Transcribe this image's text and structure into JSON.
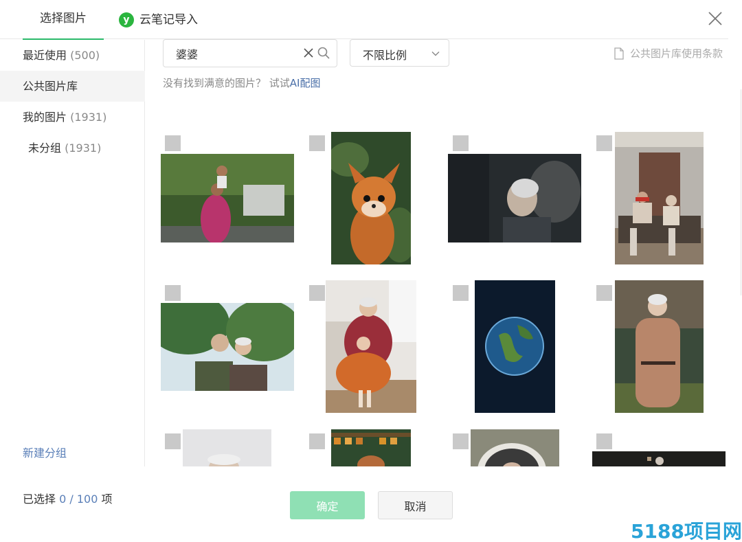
{
  "tabs": {
    "select_image": "选择图片",
    "import": "云笔记导入"
  },
  "sidebar": {
    "recent": {
      "label": "最近使用",
      "count": "(500)"
    },
    "public": {
      "label": "公共图片库"
    },
    "mine": {
      "label": "我的图片",
      "count": "(1931)"
    },
    "ungrouped": {
      "label": "未分组",
      "count": "(1931)"
    },
    "new_group": "新建分组"
  },
  "search": {
    "value": "婆婆",
    "placeholder": ""
  },
  "ratio": {
    "selected": "不限比例"
  },
  "terms": "公共图片库使用条款",
  "hint": {
    "text": "没有找到满意的图片？ 试试",
    "link": "AI配图"
  },
  "footer": {
    "selected_prefix": "已选择 ",
    "selected_value": "0 / 100",
    "selected_suffix": " 项",
    "ok": "确定",
    "cancel": "取消"
  },
  "images": [
    {
      "name": "grandmother-with-child-on-shoulders",
      "selected": false
    },
    {
      "name": "fox-cub-in-forest",
      "selected": false
    },
    {
      "name": "elderly-woman-in-crowd",
      "selected": false
    },
    {
      "name": "elderly-couple-on-sofa",
      "selected": false
    },
    {
      "name": "smiling-elderly-couple-outdoors",
      "selected": false
    },
    {
      "name": "grandmother-and-girl-in-tutu",
      "selected": false
    },
    {
      "name": "earth-from-space",
      "selected": false
    },
    {
      "name": "elderly-woman-in-coat-garden",
      "selected": false
    },
    {
      "name": "elderly-portrait-light",
      "selected": false
    },
    {
      "name": "woman-in-store-shelves",
      "selected": false
    },
    {
      "name": "portrait-in-round-frame",
      "selected": false
    },
    {
      "name": "elderly-dark-scene",
      "selected": false
    }
  ],
  "colors": {
    "accent": "#2bb96a",
    "ok_button_disabled": "#8fe0b4",
    "link": "#5a7fb8",
    "watermark": "#2aa3d8"
  },
  "watermark": "5188项目网"
}
